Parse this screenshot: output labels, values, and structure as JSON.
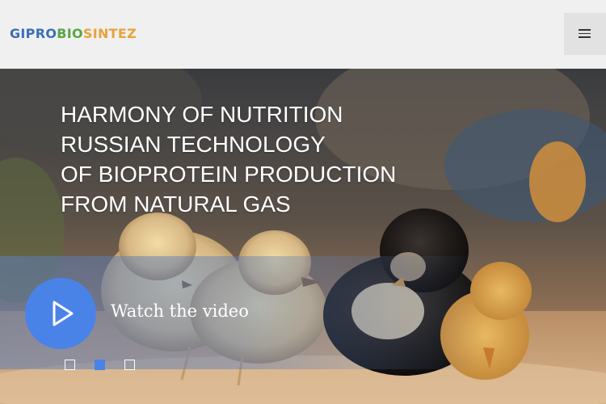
{
  "header": {
    "logo": {
      "part1": "GIPRO",
      "part2": "BIO",
      "part3": "SINTEZ",
      "colors": {
        "part1": "#3a6fb8",
        "part2": "#5aa547",
        "part3": "#e8a23b"
      }
    },
    "menu_icon": "hamburger-icon"
  },
  "hero": {
    "headline_lines": [
      "HARMONY OF NUTRITION",
      "RUSSIAN TECHNOLOGY",
      "OF BIOPROTEIN PRODUCTION",
      "FROM NATURAL GAS"
    ],
    "video_label": "Watch the video",
    "play_icon": "play-icon",
    "slides": {
      "count": 3,
      "active_index": 1
    },
    "accent_color": "#4a83e8"
  }
}
